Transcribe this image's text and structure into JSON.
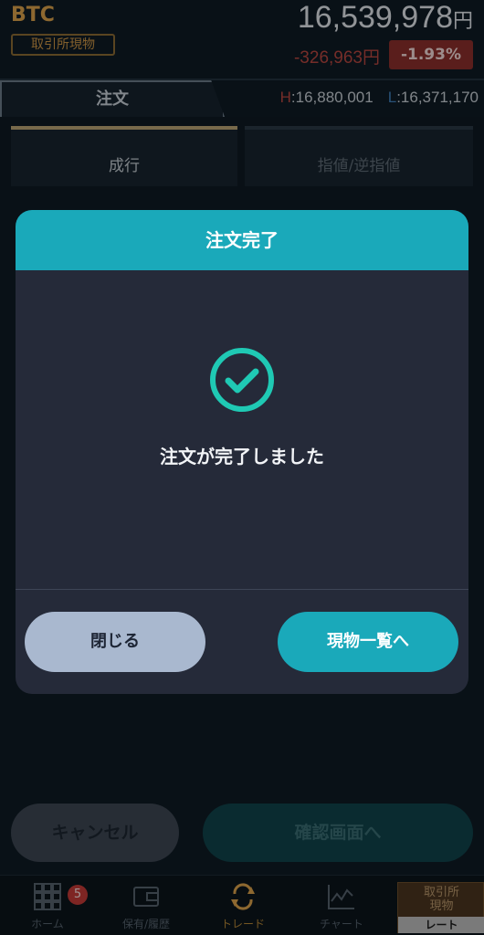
{
  "header": {
    "symbol": "BTC",
    "market_badge": "取引所現物",
    "price": "16,539,978",
    "price_unit": "円",
    "change": "-326,963円",
    "change_pct": "-1.93%",
    "high_label": "H",
    "high_value": ":16,880,001",
    "low_label": "L",
    "low_value": ":16,371,170"
  },
  "tabs": {
    "order": "注文",
    "market_order": "成行",
    "limit_order": "指値/逆指値"
  },
  "actions": {
    "cancel": "キャンセル",
    "confirm": "確認画面へ"
  },
  "modal": {
    "title": "注文完了",
    "message": "注文が完了しました",
    "close": "閉じる",
    "to_list": "現物一覧へ"
  },
  "nav": {
    "home": "ホーム",
    "home_badge": "5",
    "holdings": "保有/履歴",
    "trade": "トレード",
    "chart": "チャート",
    "rate_top": "取引所\n現物",
    "rate_bottom": "レート"
  },
  "colors": {
    "accent": "#1aa9ba",
    "gold": "#d9a04a",
    "down": "#b5463f"
  }
}
